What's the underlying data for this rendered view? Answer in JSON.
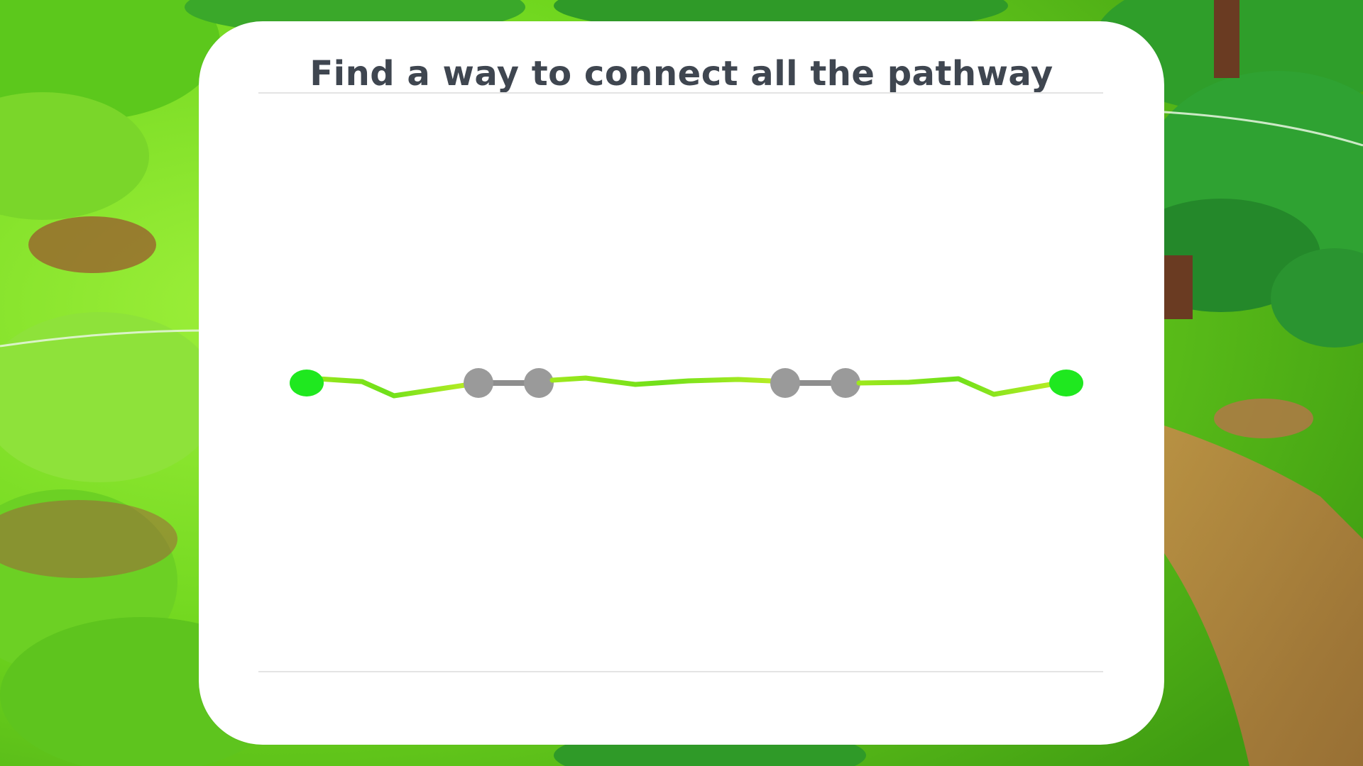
{
  "instruction": {
    "title": "Find a way to connect all the pathway"
  },
  "colors": {
    "panel": "#ffffff",
    "title_text": "#3f4650",
    "path_green": "#7ee81c",
    "endpoint_green": "#1fe81f",
    "connector_gray": "#8e8e8e",
    "node_gray": "#9a9a9a",
    "divider": "#e4e4e4"
  },
  "puzzle": {
    "endpoints": [
      "start-node",
      "end-node"
    ],
    "connectors_count": 2,
    "path_segments_count": 3
  },
  "scene": {
    "background": "forest-terrain"
  }
}
